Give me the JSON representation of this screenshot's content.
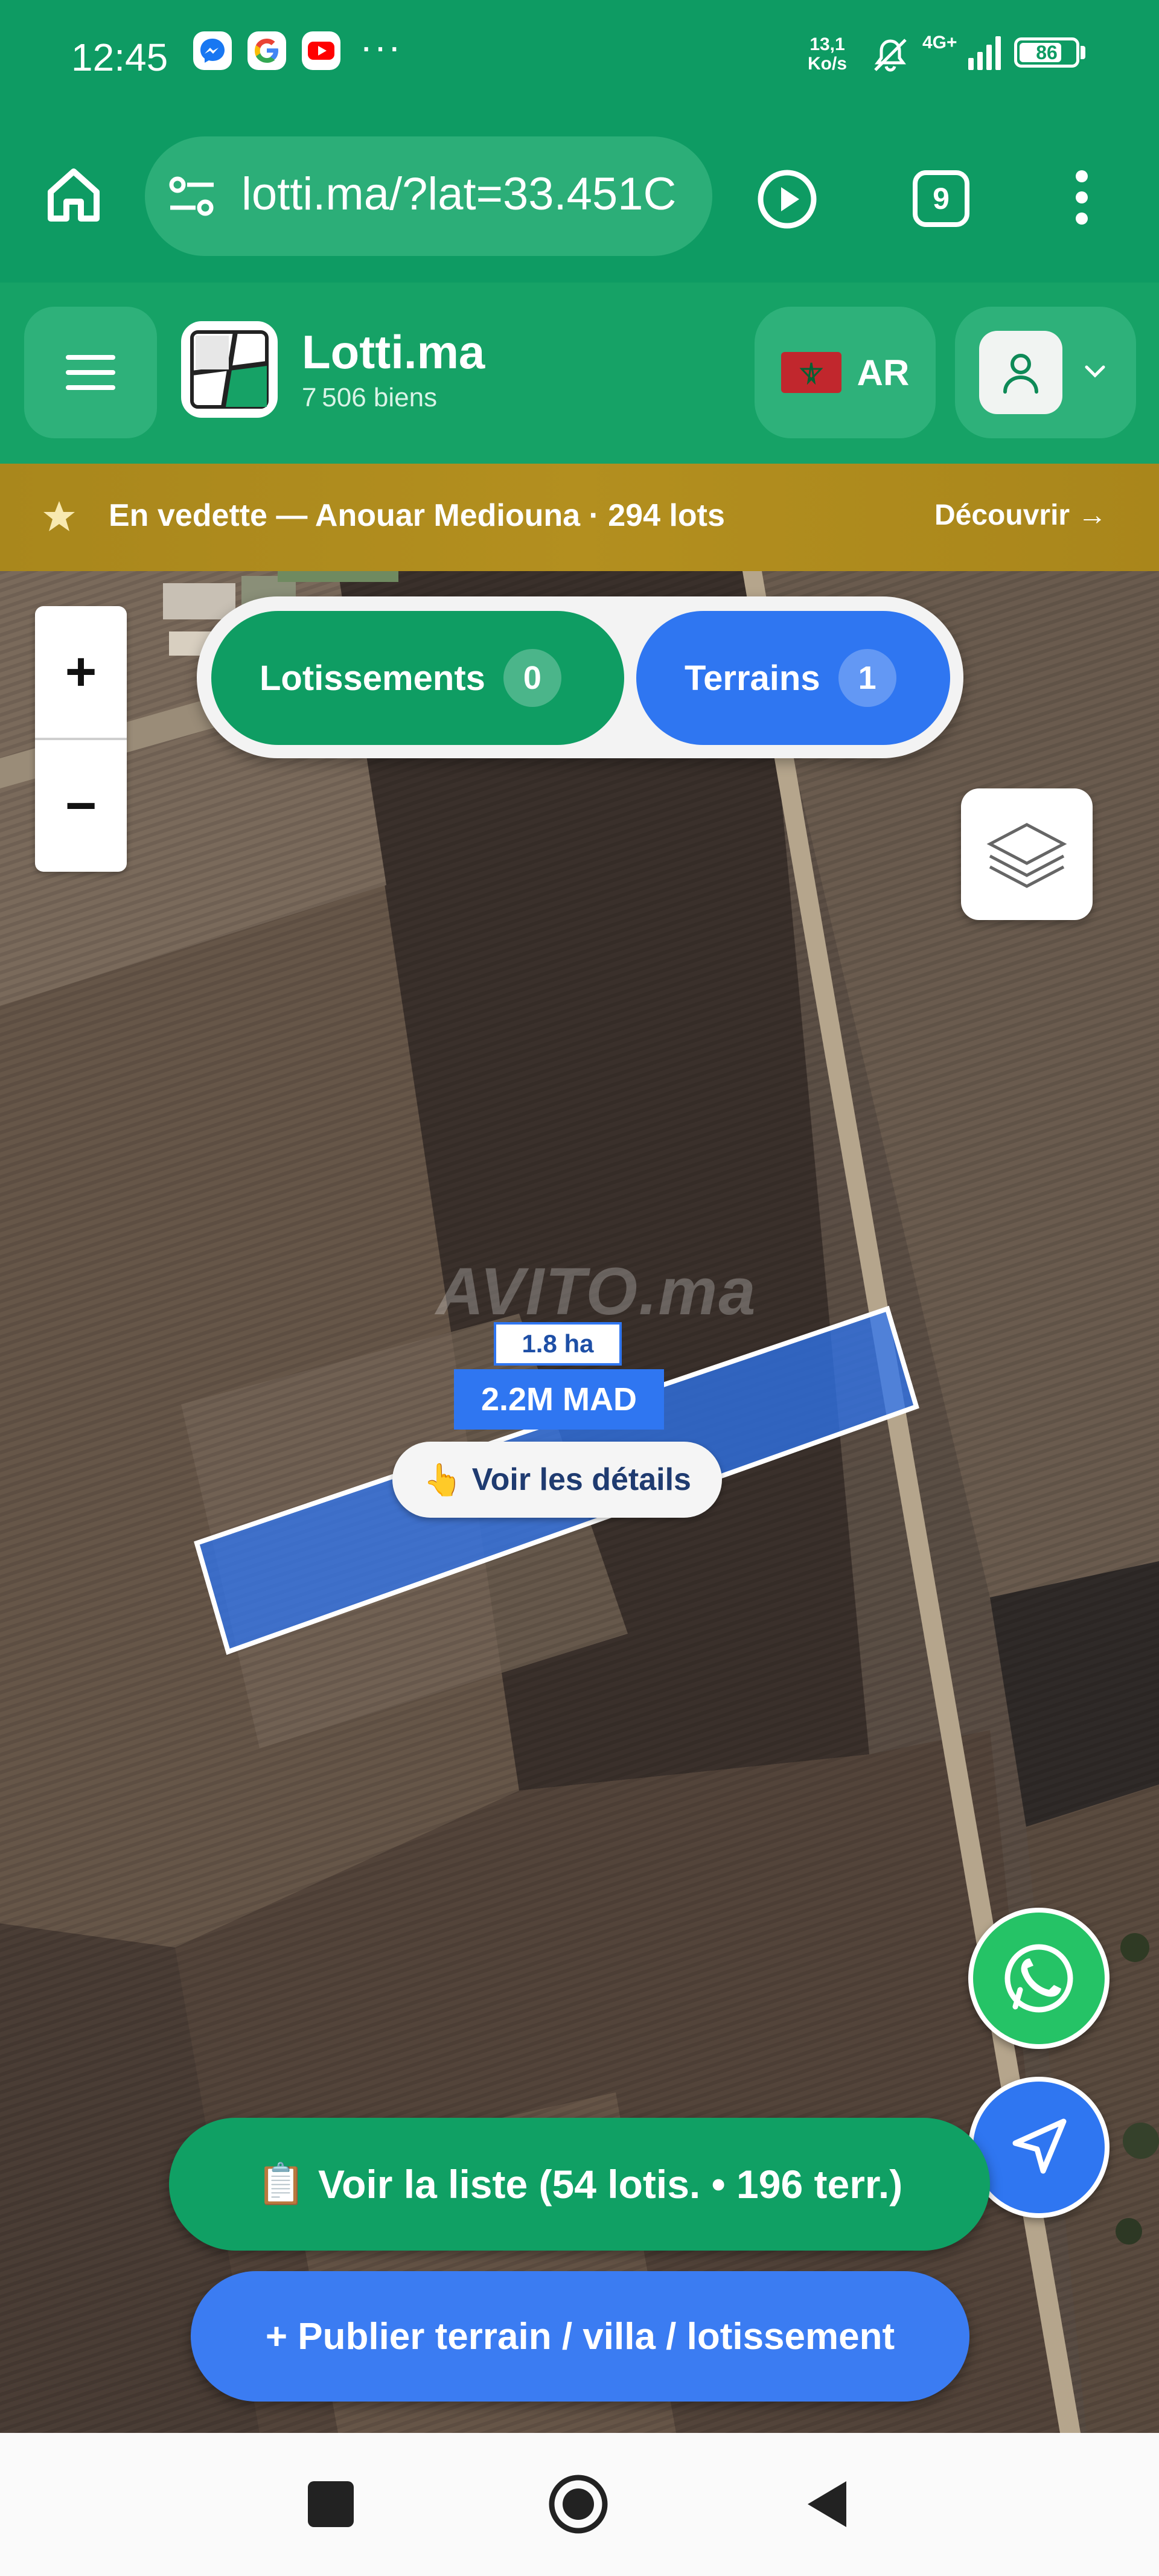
{
  "status_bar": {
    "time": "12:45",
    "apps": [
      "messenger-icon",
      "google-icon",
      "youtube-icon"
    ],
    "more": "···",
    "speed_value": "13,1",
    "speed_unit": "Ko/s",
    "network": "4G+",
    "battery": "86"
  },
  "browser": {
    "url": "lotti.ma/?lat=33.451C",
    "tab_count": "9"
  },
  "header": {
    "brand": "Lotti.ma",
    "count": "7 506 biens",
    "lang": "AR"
  },
  "banner": {
    "text": "En vedette — Anouar Mediouna · 294 lots",
    "link": "Découvrir →"
  },
  "map": {
    "zoom_in": "+",
    "zoom_out": "−",
    "tabs": [
      {
        "label": "Lotissements",
        "count": "0"
      },
      {
        "label": "Terrains",
        "count": "1"
      }
    ],
    "parcel": {
      "area": "1.8 ha",
      "price": "2.2M MAD",
      "details_icon": "👆",
      "details": "Voir les détails"
    },
    "watermark": "AVITO.ma"
  },
  "actions": {
    "list_icon": "📋",
    "list": "Voir la liste (54 lotis. • 196 terr.)",
    "publish": "+ Publier terrain / villa / lotissement"
  },
  "colors": {
    "brand_green": "#0e9b63",
    "brand_blue": "#2f76f1",
    "banner_gold": "#b08d1e"
  }
}
